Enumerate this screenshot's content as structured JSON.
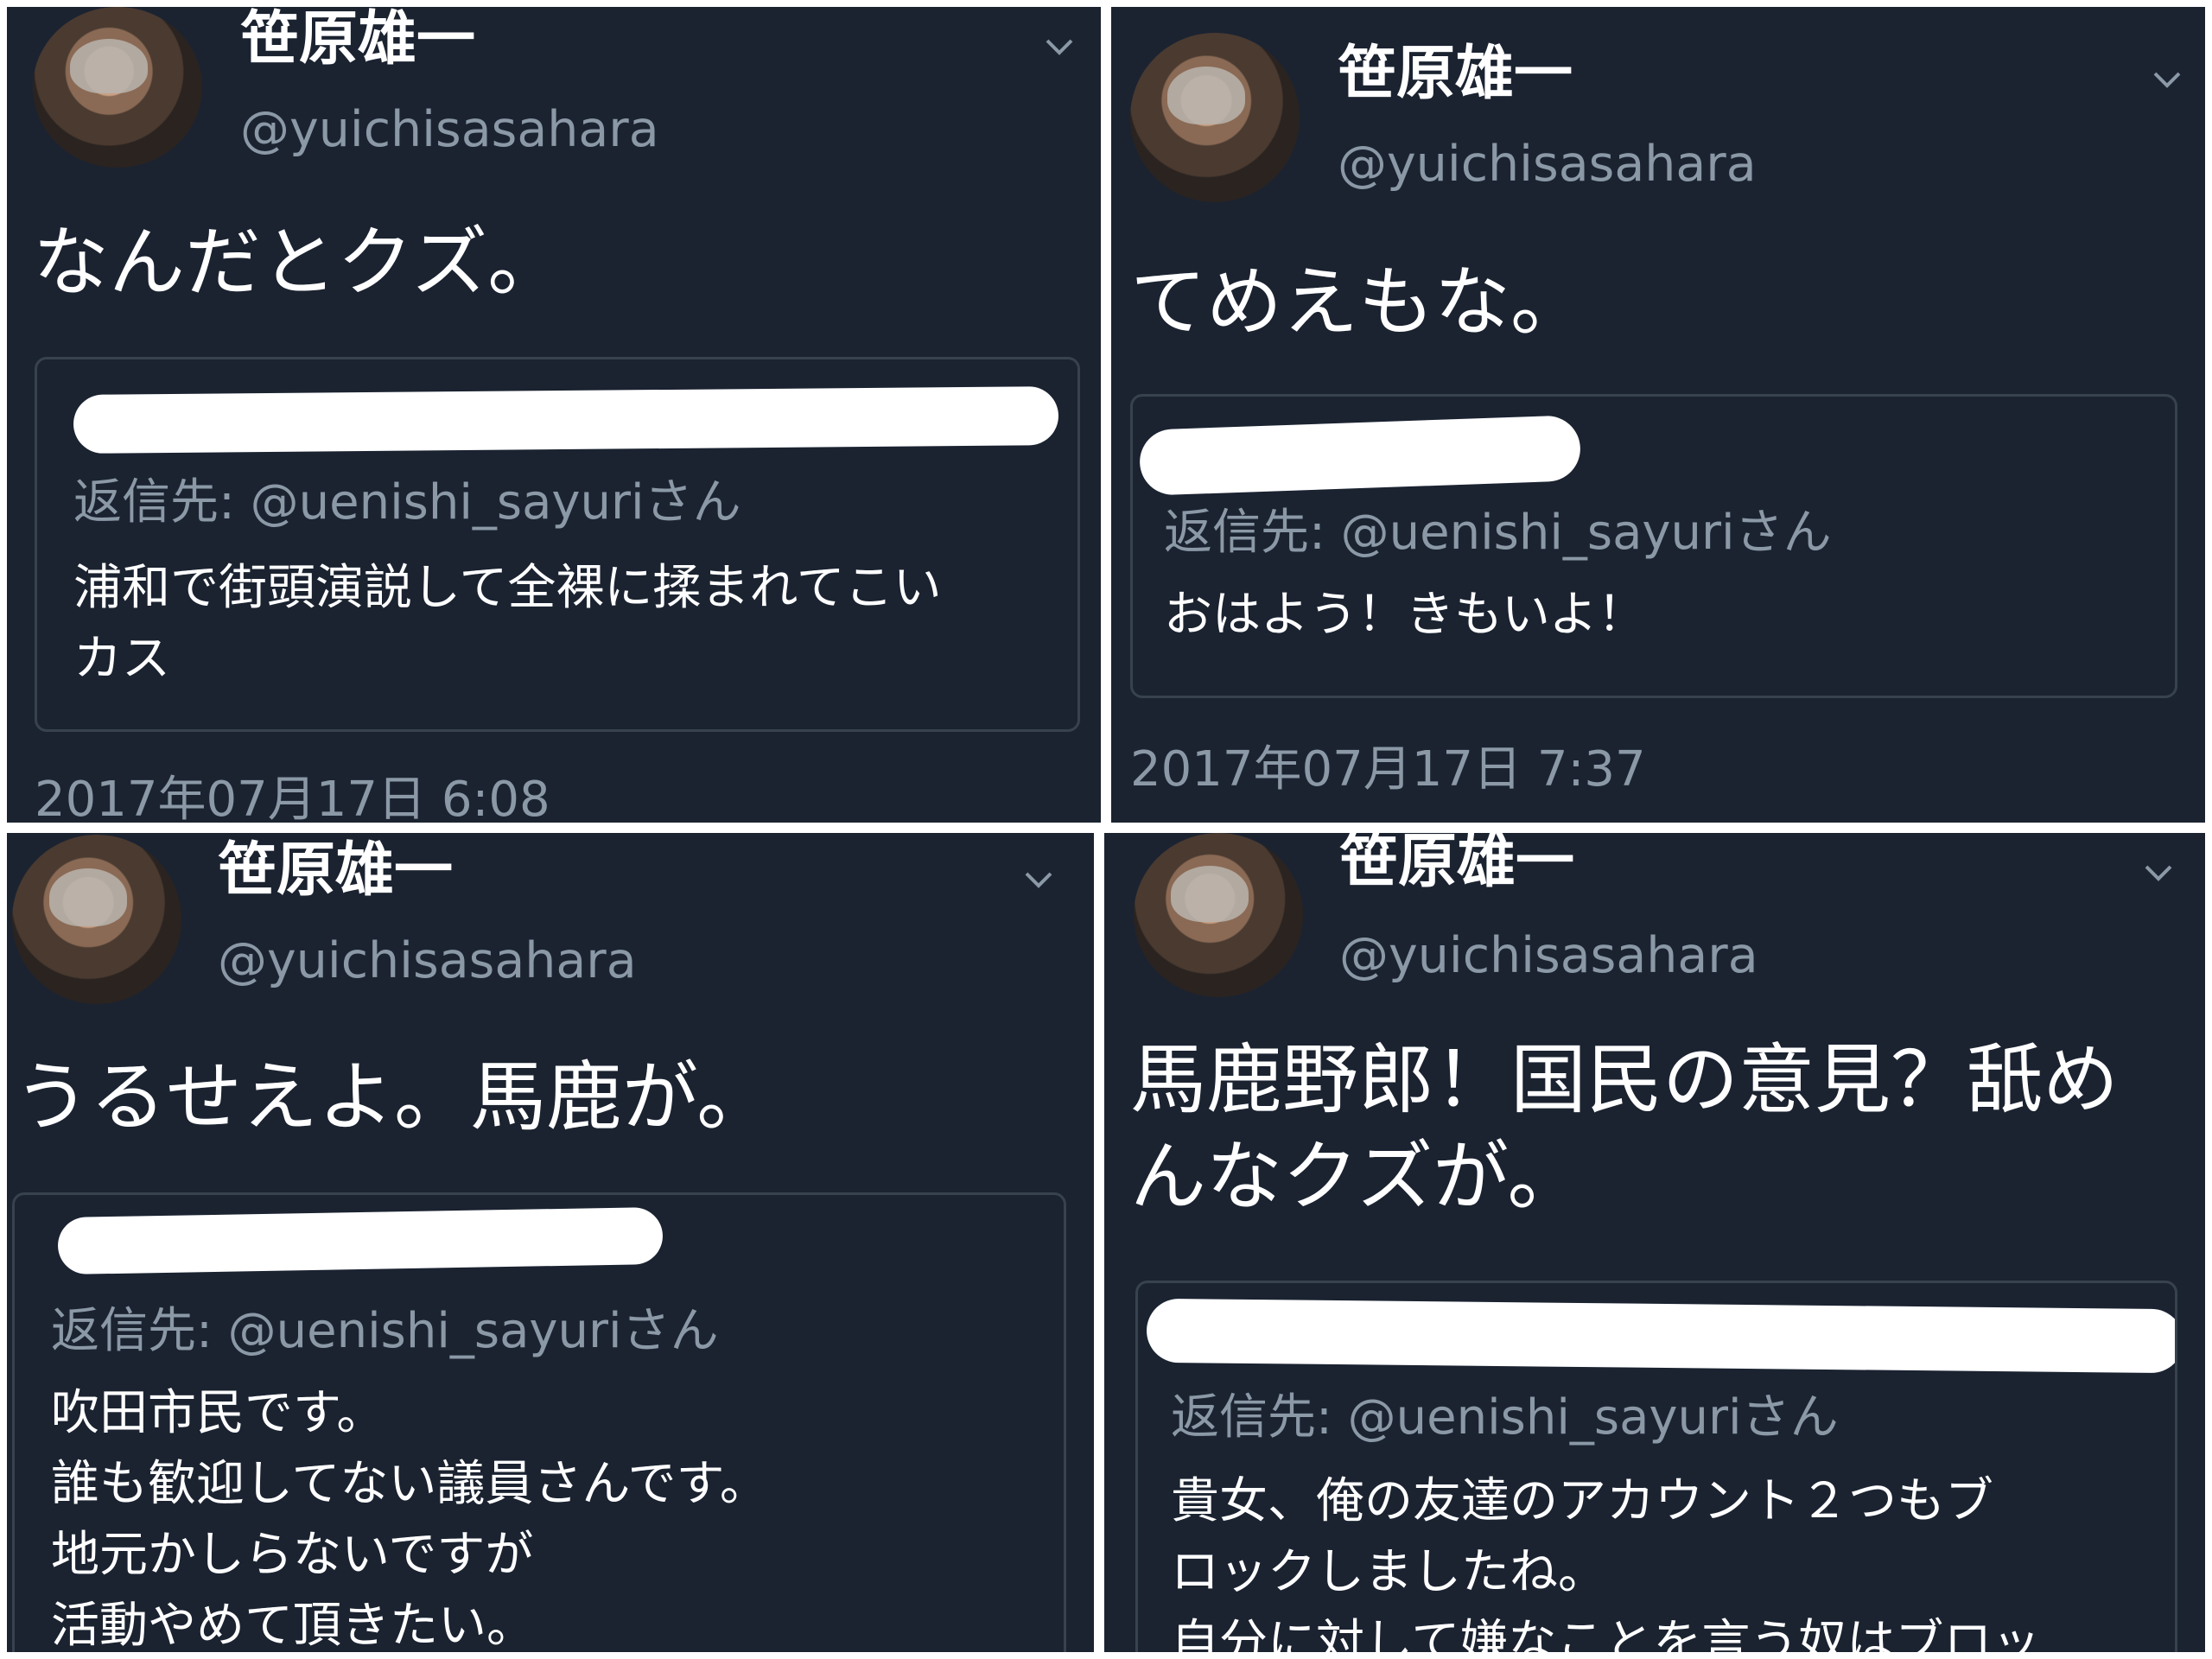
{
  "tweets": [
    {
      "author_name": "笹原雄一",
      "author_handle": "@yuichisasahara",
      "text": "なんだとクズ。",
      "quoted": {
        "reply_to": "返信先: @uenishi_sayuriさん",
        "text": "浦和で街頭演説して全裸に揉まれてこい\nカス"
      },
      "timestamp": "2017年07月17日 6:08"
    },
    {
      "author_name": "笹原雄一",
      "author_handle": "@yuichisasahara",
      "text": "てめえもな。",
      "quoted": {
        "reply_to": "返信先: @uenishi_sayuriさん",
        "text": "おはよう！きもいよ！"
      },
      "timestamp": "2017年07月17日 7:37"
    },
    {
      "author_name": "笹原雄一",
      "author_handle": "@yuichisasahara",
      "text": "うるせえよ。馬鹿が。",
      "quoted": {
        "reply_to": "返信先: @uenishi_sayuriさん",
        "text": "吹田市民です。\n誰も歓迎してない議員さんです。\n地元かしらないですが\n活動やめて頂きたい。"
      }
    },
    {
      "author_name": "笹原雄一",
      "author_handle": "@yuichisasahara",
      "text": "馬鹿野郎！国民の意見？舐め\nんなクズが。",
      "quoted": {
        "reply_to": "返信先: @uenishi_sayuriさん",
        "text": "貴女、俺の友達のアカウント２つもブ\nロックしましたね。\n自分に対して嫌なことを言う奴はブロッ"
      }
    }
  ],
  "colors": {
    "panel_bg": "#1b2331",
    "text_primary": "#ffffff",
    "text_secondary": "#8b98a6",
    "quote_border": "#38424f",
    "redaction": "#ffffff"
  },
  "icons": {
    "avatar": "profile-photo",
    "menu": "chevron-down-icon"
  }
}
